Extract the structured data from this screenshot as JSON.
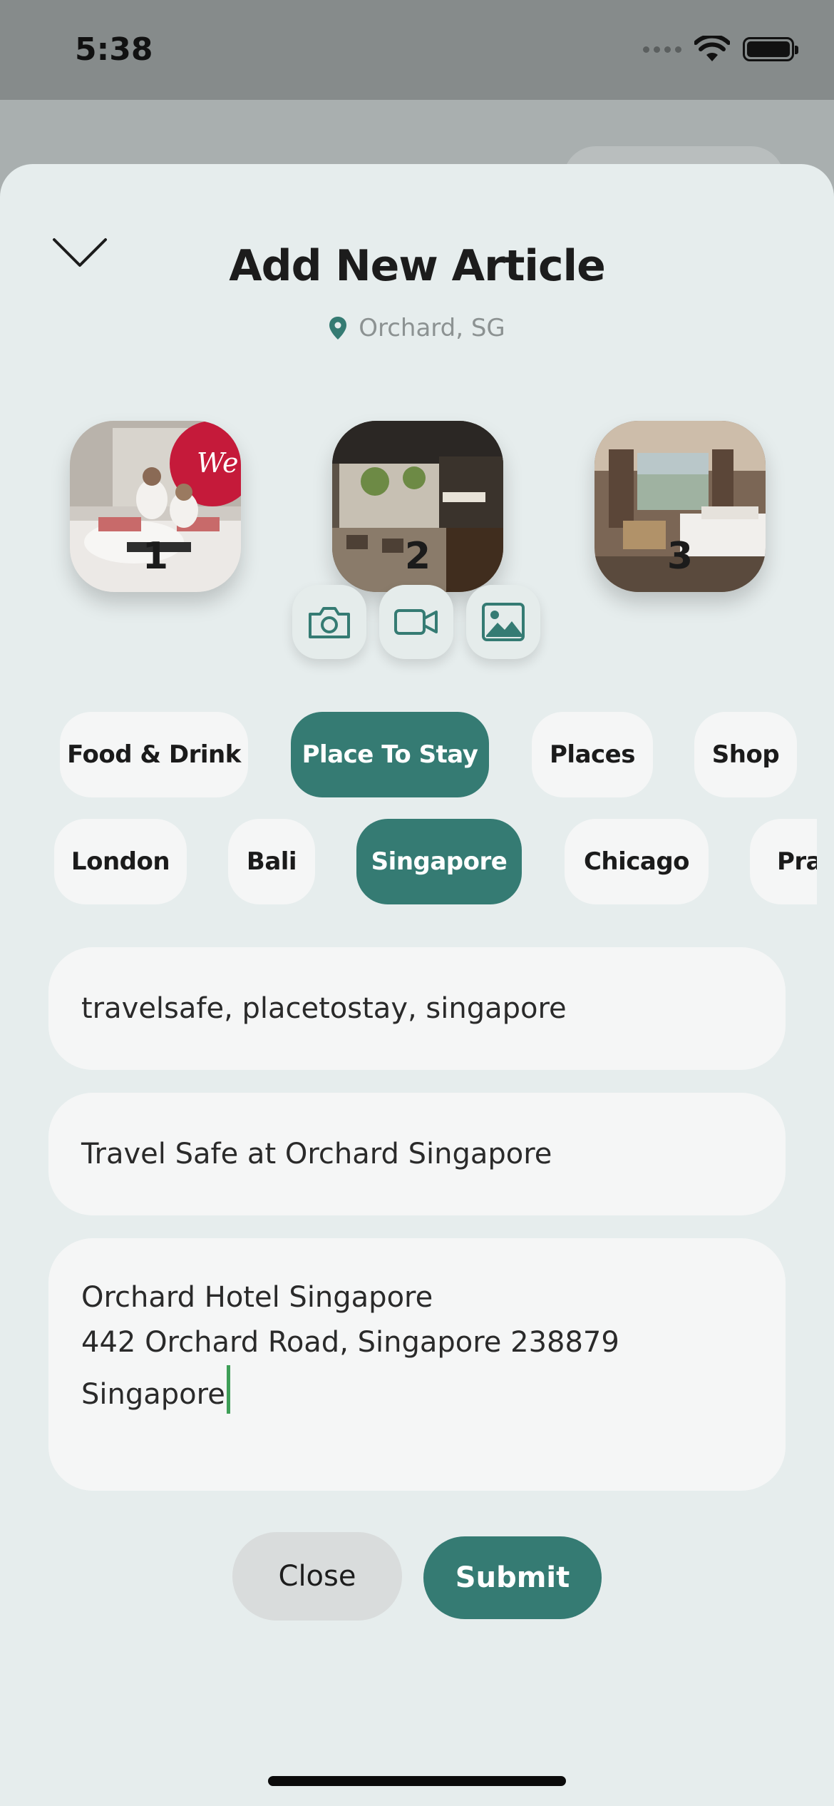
{
  "status_bar": {
    "time": "5:38"
  },
  "sheet": {
    "title": "Add New Article",
    "location": "Orchard, SG",
    "photos": [
      {
        "number": "1"
      },
      {
        "number": "2"
      },
      {
        "number": "3"
      }
    ],
    "media_buttons": [
      "camera-icon",
      "video-icon",
      "image-icon"
    ],
    "categories": [
      {
        "label": "Food & Drink",
        "selected": false
      },
      {
        "label": "Place To Stay",
        "selected": true
      },
      {
        "label": "Places",
        "selected": false
      },
      {
        "label": "Shop",
        "selected": false
      }
    ],
    "cities": [
      {
        "label": "London",
        "selected": false
      },
      {
        "label": "Bali",
        "selected": false
      },
      {
        "label": "Singapore",
        "selected": true
      },
      {
        "label": "Chicago",
        "selected": false
      },
      {
        "label": "Prag",
        "selected": false
      }
    ],
    "tags_value": "travelsafe, placetostay, singapore",
    "article_title_value": "Travel Safe at Orchard Singapore",
    "description_lines": [
      "Orchard Hotel Singapore",
      "442 Orchard Road, Singapore 238879",
      "Singapore"
    ],
    "close_label": "Close",
    "submit_label": "Submit"
  },
  "colors": {
    "accent": "#357b73",
    "sheet_bg": "#e6eded",
    "field_bg": "#f5f6f6",
    "caret": "#3e9e57"
  }
}
